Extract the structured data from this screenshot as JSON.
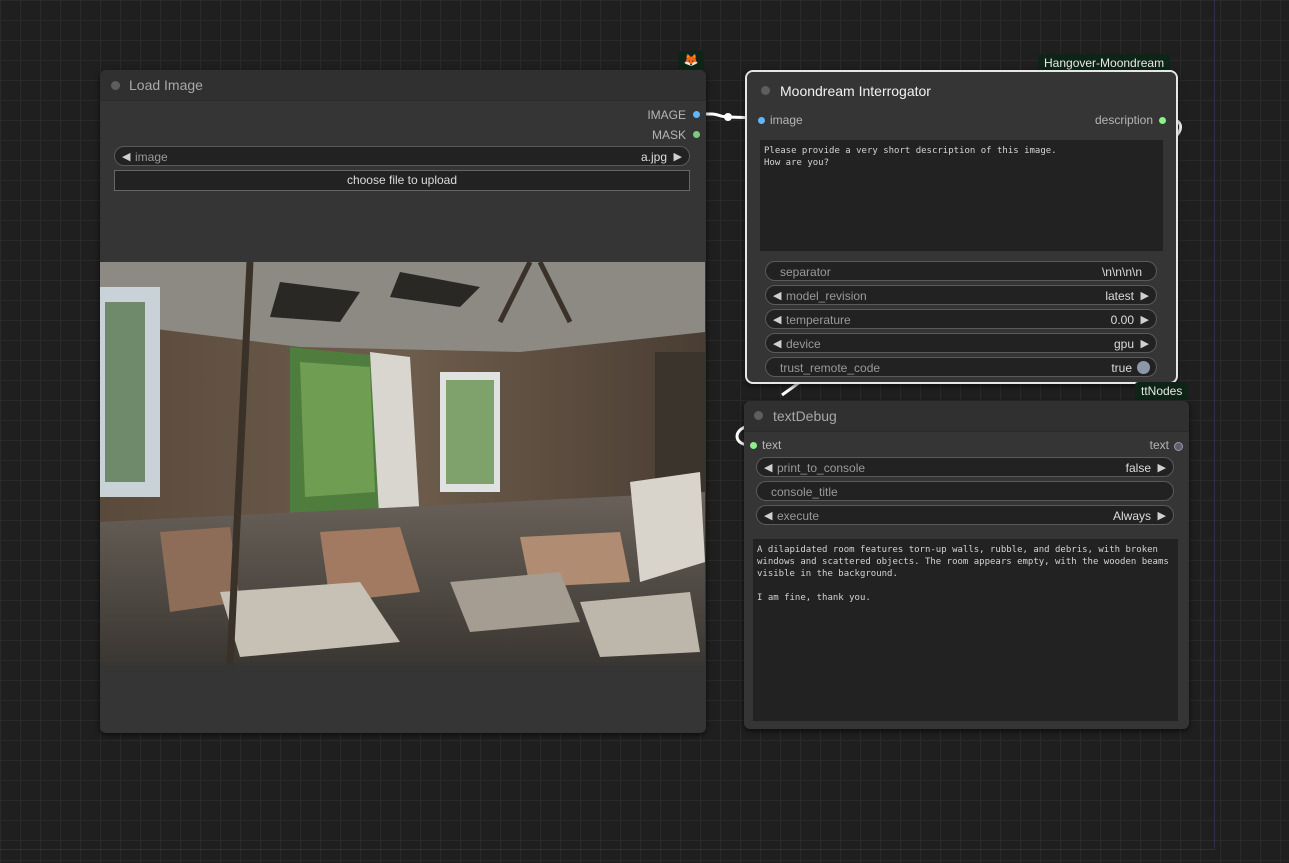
{
  "load_image": {
    "title": "Load Image",
    "badge_icon": "fox-icon",
    "outputs": [
      "IMAGE",
      "MASK"
    ],
    "image_widget": {
      "name": "image",
      "value": "a.jpg"
    },
    "upload_label": "choose file to upload",
    "preview_icon": "destroyed-room-photo"
  },
  "moondream": {
    "badge": "Hangover-Moondream",
    "title": "Moondream Interrogator",
    "input": "image",
    "output": "description",
    "prompt": "Please provide a very short description of this image.\nHow are you?",
    "widgets": {
      "separator": {
        "name": "separator",
        "value": "\\n\\n\\n\\n"
      },
      "model_revision": {
        "name": "model_revision",
        "value": "latest"
      },
      "temperature": {
        "name": "temperature",
        "value": "0.00"
      },
      "device": {
        "name": "device",
        "value": "gpu"
      },
      "trust_remote_code": {
        "name": "trust_remote_code",
        "value": "true"
      }
    }
  },
  "text_debug": {
    "badge": "ttNodes",
    "title": "textDebug",
    "input": "text",
    "output": "text",
    "widgets": {
      "print_to_console": {
        "name": "print_to_console",
        "value": "false"
      },
      "console_title": {
        "name": "console_title"
      },
      "execute": {
        "name": "execute",
        "value": "Always"
      }
    },
    "output_text": "A dilapidated room features torn-up walls, rubble, and debris, with broken windows and scattered objects. The room appears empty, with the wooden beams visible in the background.\n\nI am fine, thank you."
  },
  "colors": {
    "image_slot": "#64b5f6",
    "mask_slot": "#81c784",
    "string_slot": "#8bf08b",
    "badge_bg": "#0e2417"
  }
}
